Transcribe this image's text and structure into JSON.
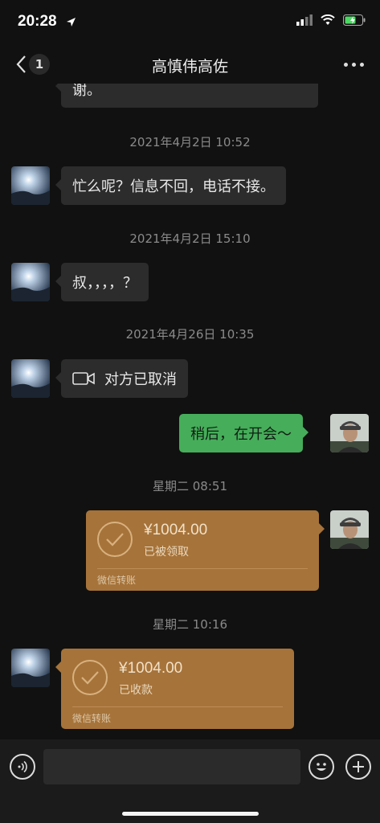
{
  "status_bar": {
    "time": "20:28"
  },
  "nav": {
    "unread_count": "1",
    "title": "高慎伟高佐"
  },
  "messages": {
    "partial_text": "谢。",
    "ts1": "2021年4月2日 10:52",
    "msg1": "忙么呢？信息不回，电话不接。",
    "ts2": "2021年4月2日 15:10",
    "msg2": "叔，，，，？",
    "ts3": "2021年4月26日 10:35",
    "msg3": "对方已取消",
    "msg4": "稍后，在开会～",
    "ts4": "星期二 08:51",
    "transfer1": {
      "amount": "¥1004.00",
      "status": "已被领取",
      "footer": "微信转账"
    },
    "ts5": "星期二 10:16",
    "transfer2": {
      "amount": "¥1004.00",
      "status": "已收款",
      "footer": "微信转账"
    }
  },
  "input": {
    "placeholder": ""
  },
  "colors": {
    "outgoing_bubble": "#46ad5a",
    "transfer_card": "#a6733a",
    "incoming_bubble": "#2c2c2c"
  }
}
